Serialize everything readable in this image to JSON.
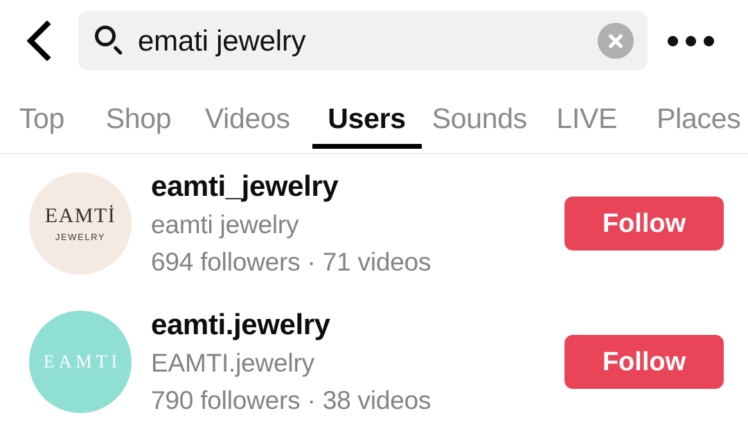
{
  "header": {
    "back_icon": "chevron-left-icon",
    "more_icon": "ellipsis-icon",
    "search": {
      "icon": "search-icon",
      "value": "emati jewelry",
      "placeholder": "Search",
      "clear_icon": "clear-circle-icon"
    }
  },
  "tabs": {
    "active_index": 3,
    "items": [
      {
        "label": "Top"
      },
      {
        "label": "Shop"
      },
      {
        "label": "Videos"
      },
      {
        "label": "Users"
      },
      {
        "label": "Sounds"
      },
      {
        "label": "LIVE"
      },
      {
        "label": "Places"
      }
    ]
  },
  "results": [
    {
      "username": "eamti_jewelry",
      "nickname": "eamti jewelry",
      "stats": "694 followers · 71 videos",
      "follow_label": "Follow",
      "avatar": {
        "style": "cream",
        "color": "#f4eae2",
        "main_text": "EAMTİ",
        "sub_text": "JEWELRY"
      }
    },
    {
      "username": "eamti.jewelry",
      "nickname": "EAMTI.jewelry",
      "stats": "790 followers · 38 videos",
      "follow_label": "Follow",
      "avatar": {
        "style": "mint",
        "color": "#8fdfd4",
        "main_text": "EAMTI",
        "sub_text": ""
      }
    }
  ],
  "colors": {
    "accent": "#ea4458",
    "search_bg": "#f1f1f1",
    "muted_text": "#838383",
    "primary_text": "#0d0d0d"
  }
}
